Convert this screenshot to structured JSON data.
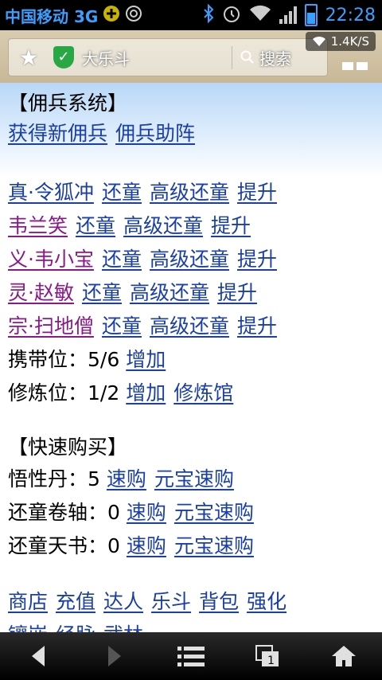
{
  "status_bar": {
    "carrier": "中国移动 3G",
    "time": "22:28"
  },
  "browser": {
    "site_title": "大乐斗",
    "search_label": "搜索",
    "speed": "1.4K/S"
  },
  "mercenary": {
    "header": "【佣兵系统】",
    "links": [
      "获得新佣兵",
      "佣兵助阵"
    ],
    "rows": [
      {
        "name": "真·令狐冲",
        "color": "#1a3fa8",
        "actions": [
          "还童",
          "高级还童",
          "提升"
        ]
      },
      {
        "name": "韦兰笑",
        "color": "#8a1a8a",
        "actions": [
          "还童",
          "高级还童",
          "提升"
        ]
      },
      {
        "name": "义·韦小宝",
        "color": "#8a1a8a",
        "actions": [
          "还童",
          "高级还童",
          "提升"
        ]
      },
      {
        "name": "灵·赵敏",
        "color": "#8a1a8a",
        "actions": [
          "还童",
          "高级还童",
          "提升"
        ]
      },
      {
        "name": "宗·扫地僧",
        "color": "#8a1a8a",
        "actions": [
          "还童",
          "高级还童",
          "提升"
        ]
      }
    ],
    "carry_label": "携带位：",
    "carry_value": "5/6",
    "carry_add": "增加",
    "train_label": "修炼位：",
    "train_value": "1/2",
    "train_add": "增加",
    "train_hall": "修炼馆"
  },
  "quick_buy": {
    "header": "【快速购买】",
    "items": [
      {
        "label": "悟性丹：",
        "count": "5",
        "buy": "速购",
        "ingot_buy": "元宝速购"
      },
      {
        "label": "还童卷轴：",
        "count": "0",
        "buy": "速购",
        "ingot_buy": "元宝速购"
      },
      {
        "label": "还童天书：",
        "count": "0",
        "buy": "速购",
        "ingot_buy": "元宝速购"
      }
    ]
  },
  "footer_links": [
    "商店",
    "充值",
    "达人",
    "乐斗",
    "背包",
    "强化"
  ],
  "footer_links_2": [
    "镶嵌",
    "经脉",
    "武林"
  ],
  "colors": {
    "link": "#1a3fa8",
    "purple_name": "#8a1a8a",
    "status_accent": "#3aa0ff"
  }
}
